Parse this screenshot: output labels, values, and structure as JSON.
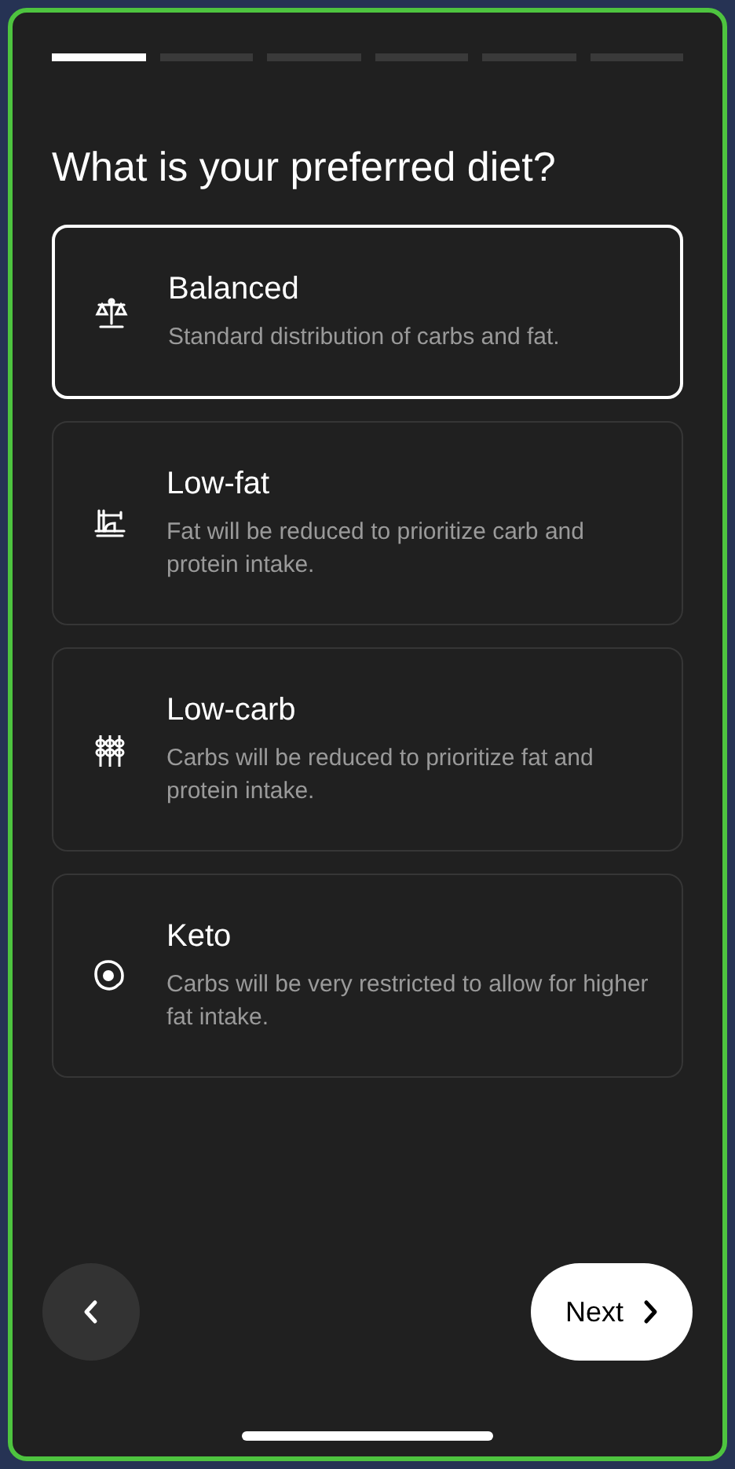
{
  "progress": [
    {
      "active": true
    },
    {
      "active": false
    },
    {
      "active": false
    },
    {
      "active": false
    },
    {
      "active": false
    },
    {
      "active": false
    }
  ],
  "title": "What is your preferred diet?",
  "options": [
    {
      "label": "Balanced",
      "description": "Standard distribution of carbs and fat.",
      "selected": true
    },
    {
      "label": "Low-fat",
      "description": "Fat will be reduced to prioritize carb and protein intake.",
      "selected": false
    },
    {
      "label": "Low-carb",
      "description": "Carbs will be reduced to prioritize fat and protein intake.",
      "selected": false
    },
    {
      "label": "Keto",
      "description": "Carbs will be very restricted to allow for higher fat intake.",
      "selected": false
    }
  ],
  "next_button": "Next"
}
